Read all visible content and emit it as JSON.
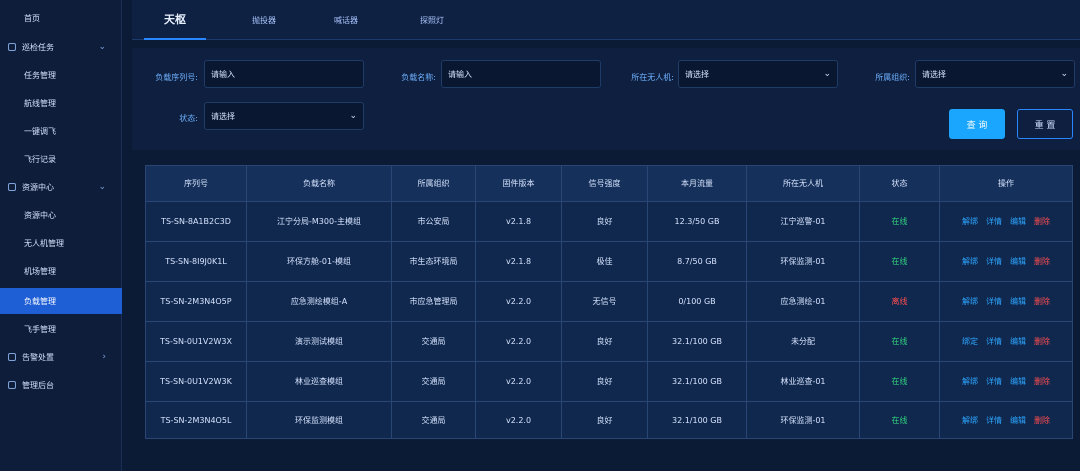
{
  "sidebar": {
    "items": [
      {
        "label": "首页",
        "type": "top"
      },
      {
        "label": "巡检任务",
        "type": "group"
      },
      {
        "label": "任务管理",
        "type": "sub"
      },
      {
        "label": "航线管理",
        "type": "sub"
      },
      {
        "label": "一键调飞",
        "type": "sub"
      },
      {
        "label": "飞行记录",
        "type": "sub"
      },
      {
        "label": "资源中心",
        "type": "group"
      },
      {
        "label": "资源中心",
        "type": "sub"
      },
      {
        "label": "无人机管理",
        "type": "sub"
      },
      {
        "label": "机场管理",
        "type": "sub"
      },
      {
        "label": "负载管理",
        "type": "sub",
        "active": true
      },
      {
        "label": "飞手管理",
        "type": "sub"
      },
      {
        "label": "告警处置",
        "type": "group-right"
      },
      {
        "label": "管理后台",
        "type": "group-noarrow"
      }
    ]
  },
  "tabs": [
    {
      "label": "天枢",
      "active": true
    },
    {
      "label": "抛投器"
    },
    {
      "label": "喊话器"
    },
    {
      "label": "探照灯"
    }
  ],
  "filters": {
    "serial_label": "负载序列号:",
    "serial_placeholder": "请输入",
    "name_label": "负载名称:",
    "name_placeholder": "请输入",
    "drone_label": "所在无人机:",
    "drone_value": "请选择",
    "org_label": "所属组织:",
    "org_value": "请选择",
    "status_label": "状态:",
    "status_value": "请选择",
    "query_button": "查 询",
    "reset_button": "重 置"
  },
  "table": {
    "columns": [
      "序列号",
      "负载名称",
      "所属组织",
      "固件版本",
      "信号强度",
      "本月流量",
      "所在无人机",
      "状态",
      "操作"
    ],
    "rows": [
      {
        "serial": "TS-SN-8A1B2C3D",
        "name": "江宁分局-M300-主模组",
        "org": "市公安局",
        "fw": "v2.1.8",
        "signal": "良好",
        "traffic": "12.3/50 GB",
        "drone": "江宁巡警-01",
        "status": "在线",
        "status_key": "online",
        "ops": [
          "解绑",
          "详情",
          "编辑",
          "删除"
        ]
      },
      {
        "serial": "TS-SN-8I9J0K1L",
        "name": "环保方舱-01-模组",
        "org": "市生态环境局",
        "fw": "v2.1.8",
        "signal": "极佳",
        "traffic": "8.7/50 GB",
        "drone": "环保监测-01",
        "status": "在线",
        "status_key": "online",
        "ops": [
          "解绑",
          "详情",
          "编辑",
          "删除"
        ]
      },
      {
        "serial": "TS-SN-2M3N4O5P",
        "name": "应急测绘模组-A",
        "org": "市应急管理局",
        "fw": "v2.2.0",
        "signal": "无信号",
        "traffic": "0/100 GB",
        "drone": "应急测绘-01",
        "status": "离线",
        "status_key": "offline",
        "ops": [
          "解绑",
          "详情",
          "编辑",
          "删除"
        ]
      },
      {
        "serial": "TS-SN-0U1V2W3X",
        "name": "演示测试模组",
        "org": "交通局",
        "fw": "v2.2.0",
        "signal": "良好",
        "traffic": "32.1/100 GB",
        "drone": "未分配",
        "status": "在线",
        "status_key": "online",
        "ops": [
          "绑定",
          "详情",
          "编辑",
          "删除"
        ]
      },
      {
        "serial": "TS-SN-0U1V2W3K",
        "name": "林业巡查模组",
        "org": "交通局",
        "fw": "v2.2.0",
        "signal": "良好",
        "traffic": "32.1/100 GB",
        "drone": "林业巡查-01",
        "status": "在线",
        "status_key": "online",
        "ops": [
          "解绑",
          "详情",
          "编辑",
          "删除"
        ]
      },
      {
        "serial": "TS-SN-2M3N4O5L",
        "name": "环保监测模组",
        "org": "交通局",
        "fw": "v2.2.0",
        "signal": "良好",
        "traffic": "32.1/100 GB",
        "drone": "环保监测-01",
        "status": "在线",
        "status_key": "online",
        "ops": [
          "解绑",
          "详情",
          "编辑",
          "删除"
        ]
      }
    ]
  },
  "colors": {
    "accent": "#1f5fd6",
    "online": "#31d07e",
    "offline": "#ff4d4f",
    "link": "#2da6ff"
  }
}
